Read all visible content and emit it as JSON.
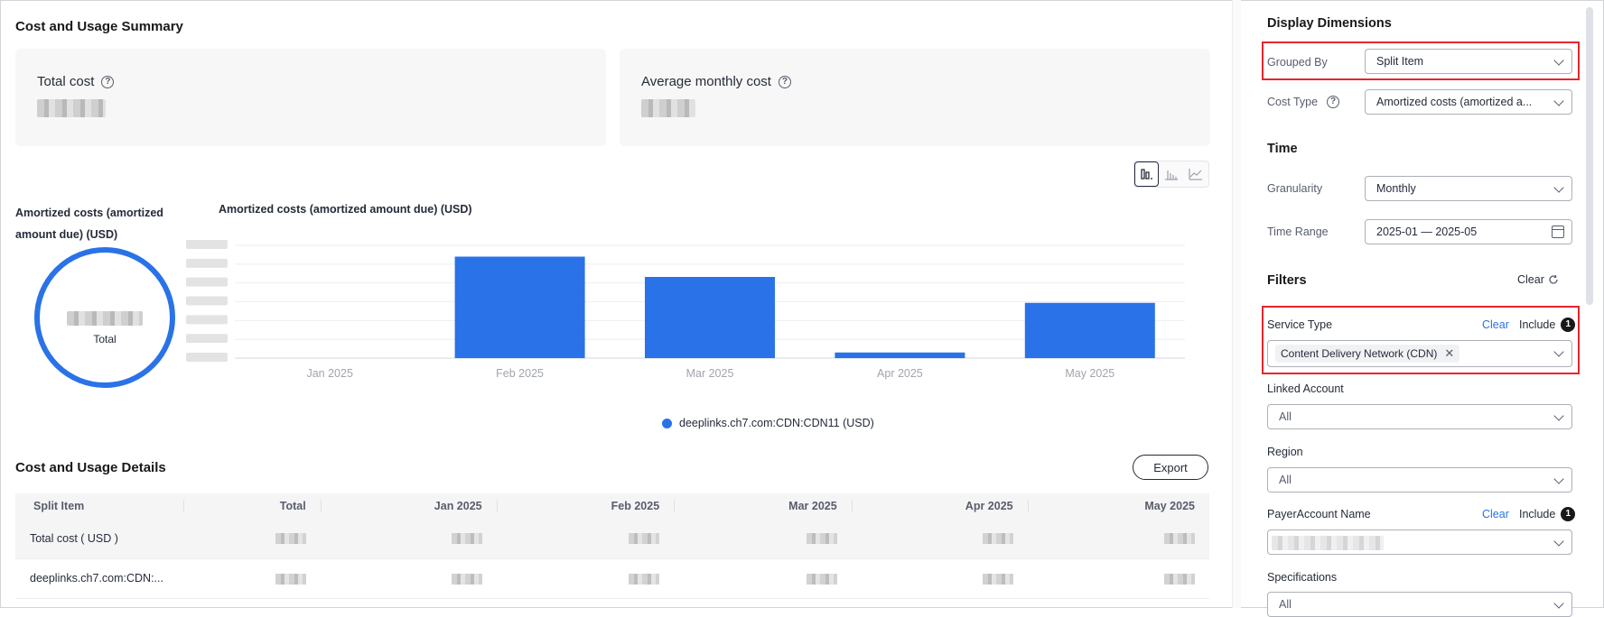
{
  "summary": {
    "title": "Cost and Usage Summary",
    "total_cost_label": "Total cost",
    "avg_monthly_label": "Average monthly cost"
  },
  "donut": {
    "title": "Amortized costs (amortized amount due) (USD)",
    "center_label": "Total"
  },
  "chart_data": {
    "type": "bar",
    "title": "Amortized costs (amortized amount due) (USD)",
    "categories": [
      "Jan 2025",
      "Feb 2025",
      "Mar 2025",
      "Apr 2025",
      "May 2025"
    ],
    "series": [
      {
        "name": "deeplinks.ch7.com:CDN:CDN11 (USD)",
        "values": [
          0,
          0.9,
          0.72,
          0.05,
          0.49
        ],
        "color": "#2a72e8"
      }
    ],
    "ylim": [
      0,
      1
    ],
    "grid": true,
    "legend": "bottom"
  },
  "details": {
    "title": "Cost and Usage Details",
    "export_label": "Export",
    "columns": [
      "Split Item",
      "Total",
      "Jan 2025",
      "Feb 2025",
      "Mar 2025",
      "Apr 2025",
      "May 2025"
    ],
    "rows": [
      {
        "label": "Total cost ( USD )"
      },
      {
        "label": "deeplinks.ch7.com:CDN:..."
      }
    ]
  },
  "sidebar": {
    "display_dimensions": "Display Dimensions",
    "grouped_by_label": "Grouped By",
    "grouped_by_value": "Split Item",
    "cost_type_label": "Cost Type",
    "cost_type_value": "Amortized costs (amortized a...",
    "time_heading": "Time",
    "granularity_label": "Granularity",
    "granularity_value": "Monthly",
    "time_range_label": "Time Range",
    "time_range_value": "2025-01 — 2025-05",
    "filters_heading": "Filters",
    "clear_all": "Clear",
    "service_type_label": "Service Type",
    "service_type_chip": "Content Delivery Network (CDN)",
    "clear_label": "Clear",
    "include_label": "Include",
    "include_count": "1",
    "linked_account_label": "Linked Account",
    "linked_account_value": "All",
    "region_label": "Region",
    "region_value": "All",
    "payer_label": "PayerAccount Name",
    "payer_clear": "Clear",
    "payer_include": "Include",
    "payer_count": "1",
    "specifications_label": "Specifications",
    "specifications_value": "All"
  },
  "colors": {
    "accent": "#2a72e8",
    "highlight": "#e5262e"
  }
}
